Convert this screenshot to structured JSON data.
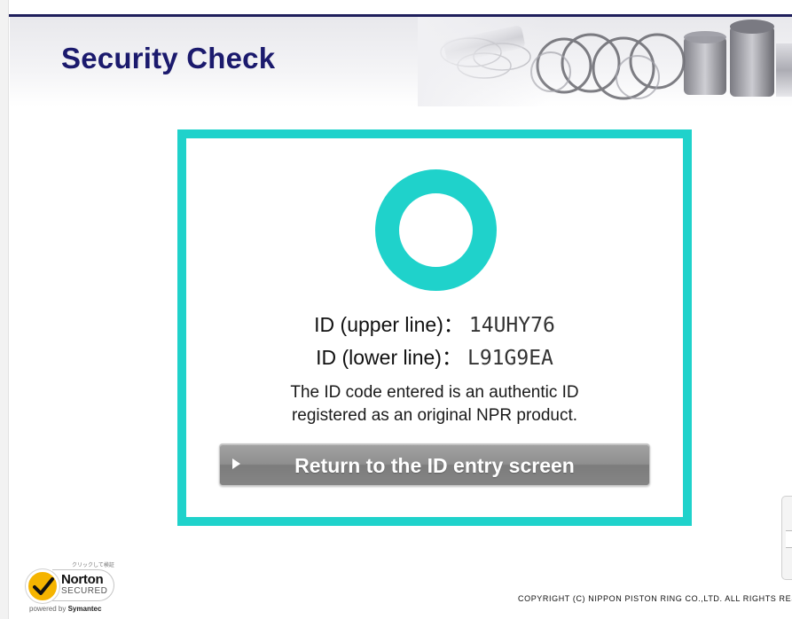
{
  "header": {
    "title": "Security Check",
    "banner_image": "piston-rings-banner"
  },
  "result": {
    "status_icon": "circle-ok-icon",
    "upper_label": "ID (upper line)：",
    "upper_value": "14UHY76",
    "lower_label": "ID (lower line)：",
    "lower_value": "L91G9EA",
    "message_line1": "The ID code entered is an authentic ID",
    "message_line2": "registered as an original NPR product.",
    "return_button": "Return to the ID entry screen"
  },
  "badge": {
    "jp_note": "クリックして検証",
    "brand": "Norton",
    "secured": "SECURED",
    "powered_prefix": "powered by",
    "powered_company": "Symantec"
  },
  "footer": {
    "copyright": "COPYRIGHT (C) NIPPON PISTON RING CO.,LTD. ALL RIGHTS RESERVED."
  },
  "colors": {
    "accent": "#1fd2cb",
    "title": "#1b1a6d",
    "top_bar": "#1f1f5c",
    "button": "#8f8f8f"
  }
}
